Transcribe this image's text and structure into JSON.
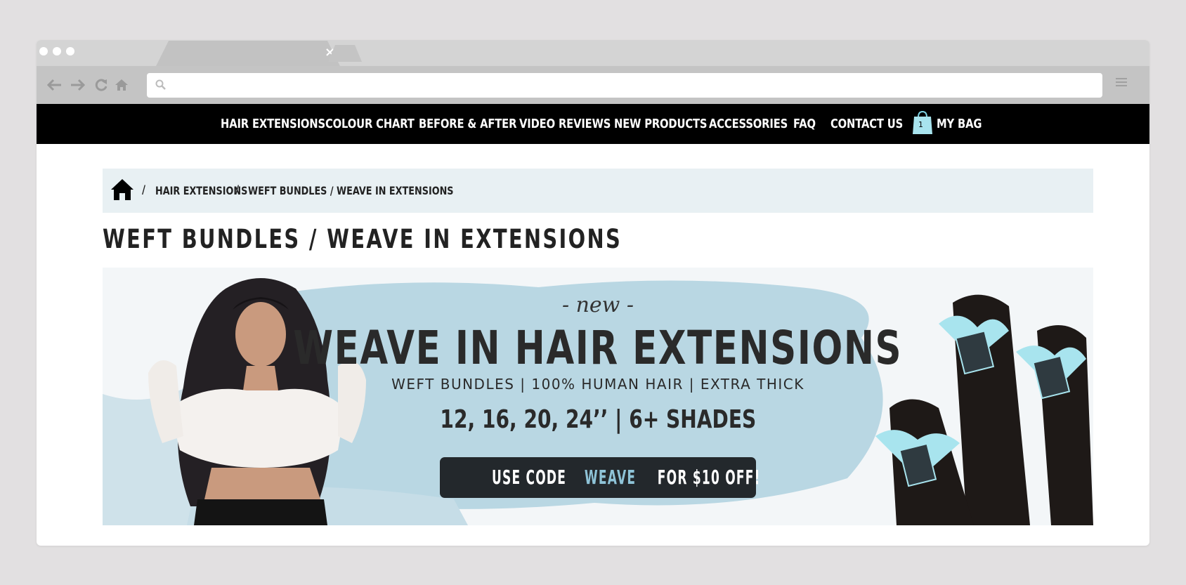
{
  "browser": {
    "tab_close": "×"
  },
  "nav": {
    "items": [
      {
        "label": "HAIR EXTENSIONS"
      },
      {
        "label": "COLOUR CHART"
      },
      {
        "label": "BEFORE & AFTER"
      },
      {
        "label": "VIDEO REVIEWS"
      },
      {
        "label": "NEW PRODUCTS"
      },
      {
        "label": "ACCESSORIES"
      },
      {
        "label": "FAQ"
      },
      {
        "label": "CONTACT US"
      }
    ],
    "bag_label": "MY BAG",
    "bag_count": "1"
  },
  "breadcrumb": {
    "separator": "/",
    "items": [
      "HAIR EXTENSIONS",
      "WEFT BUNDLES / WEAVE IN EXTENSIONS"
    ]
  },
  "page": {
    "title": "WEFT BUNDLES / WEAVE IN EXTENSIONS"
  },
  "banner": {
    "kicker": "- new -",
    "headline": "WEAVE IN HAIR EXTENSIONS",
    "subline": "WEFT BUNDLES | 100% HUMAN HAIR | EXTRA THICK",
    "sizes": "12, 16, 20, 24’’ | 6+ SHADES",
    "promo_prefix": "USE CODE ",
    "promo_code": "WEAVE",
    "promo_suffix": " FOR $10 OFF!"
  },
  "colors": {
    "nav_bg": "#000000",
    "breadcrumb_bg": "#e8f0f3",
    "promo_bg": "#23282c",
    "promo_code": "#8ec3d7",
    "ribbon": "#a8e4ee"
  }
}
